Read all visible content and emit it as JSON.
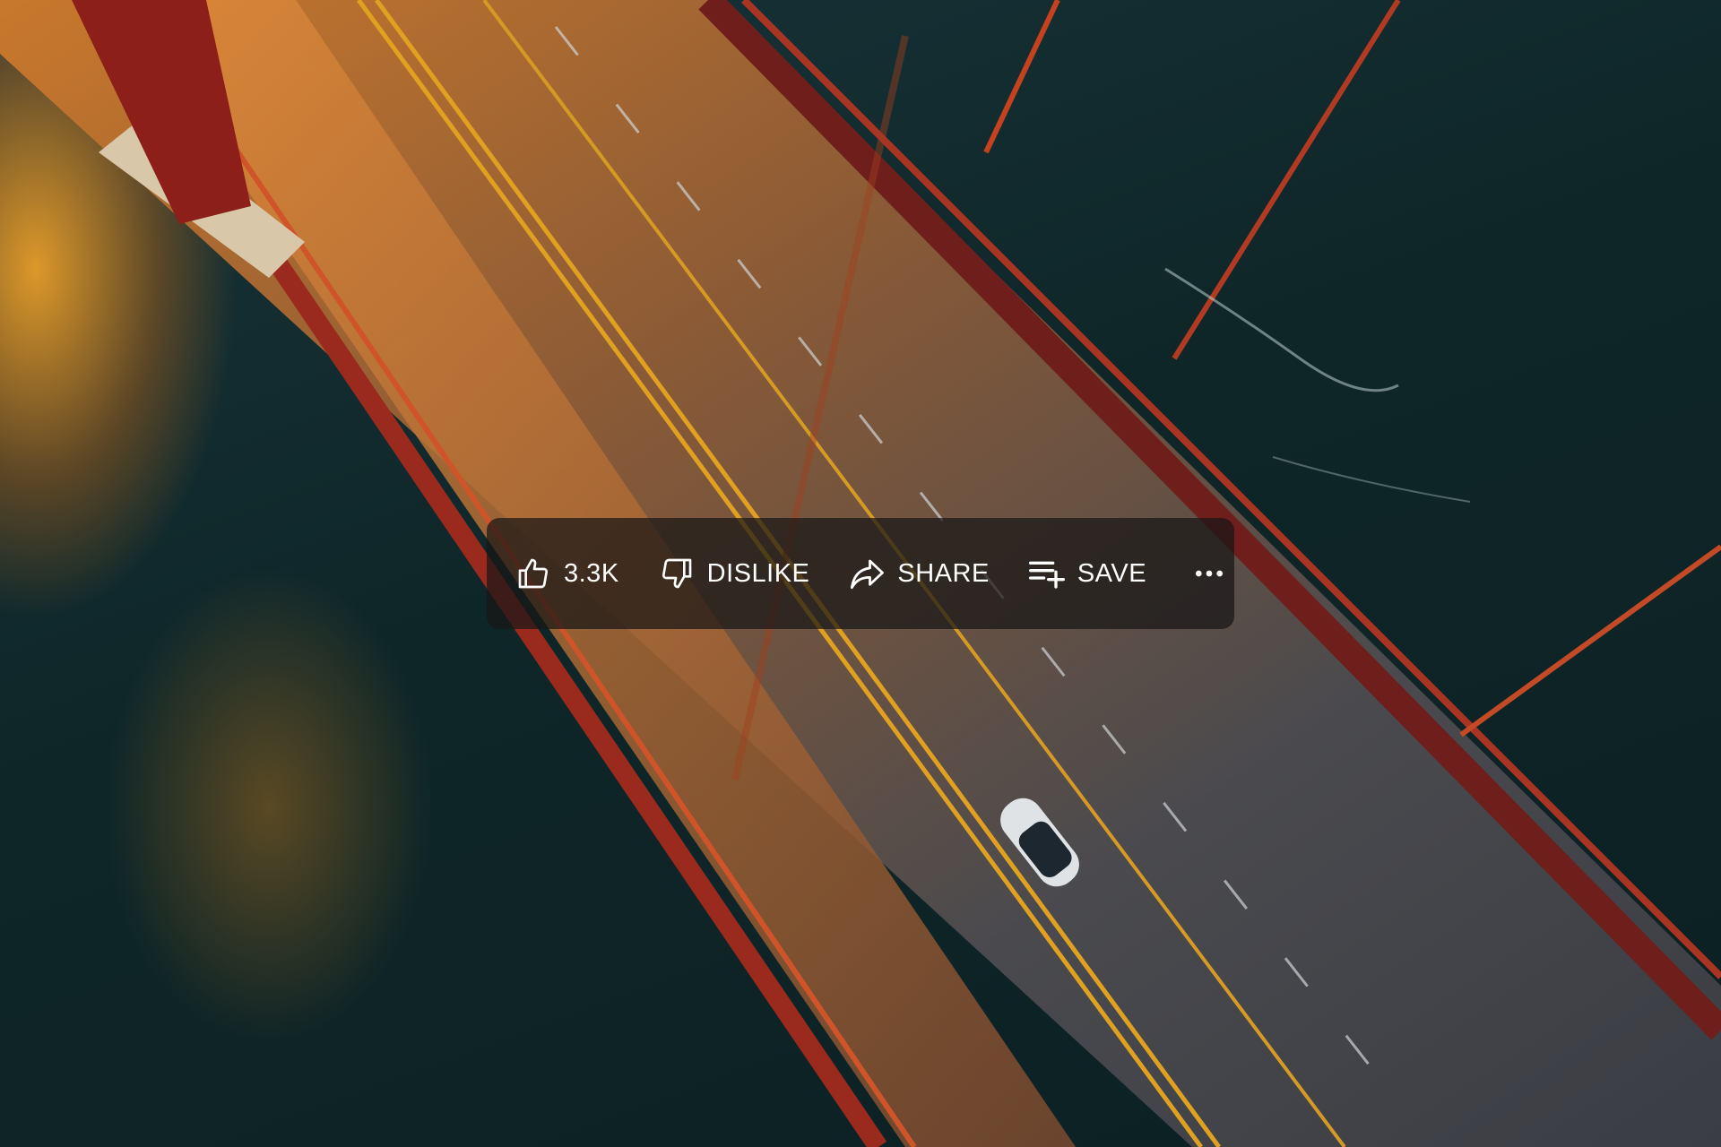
{
  "scene": {
    "description_icon": "aerial-bridge-photo"
  },
  "actions": {
    "like": {
      "label": "3.3K",
      "icon": "thumbs-up-icon"
    },
    "dislike": {
      "label": "DISLIKE",
      "icon": "thumbs-down-icon"
    },
    "share": {
      "label": "SHARE",
      "icon": "share-arrow-icon"
    },
    "save": {
      "label": "SAVE",
      "icon": "playlist-add-icon"
    },
    "more": {
      "icon": "more-horizontal-icon"
    }
  },
  "colors": {
    "bar_background": "#181616",
    "text": "#ffffff"
  }
}
